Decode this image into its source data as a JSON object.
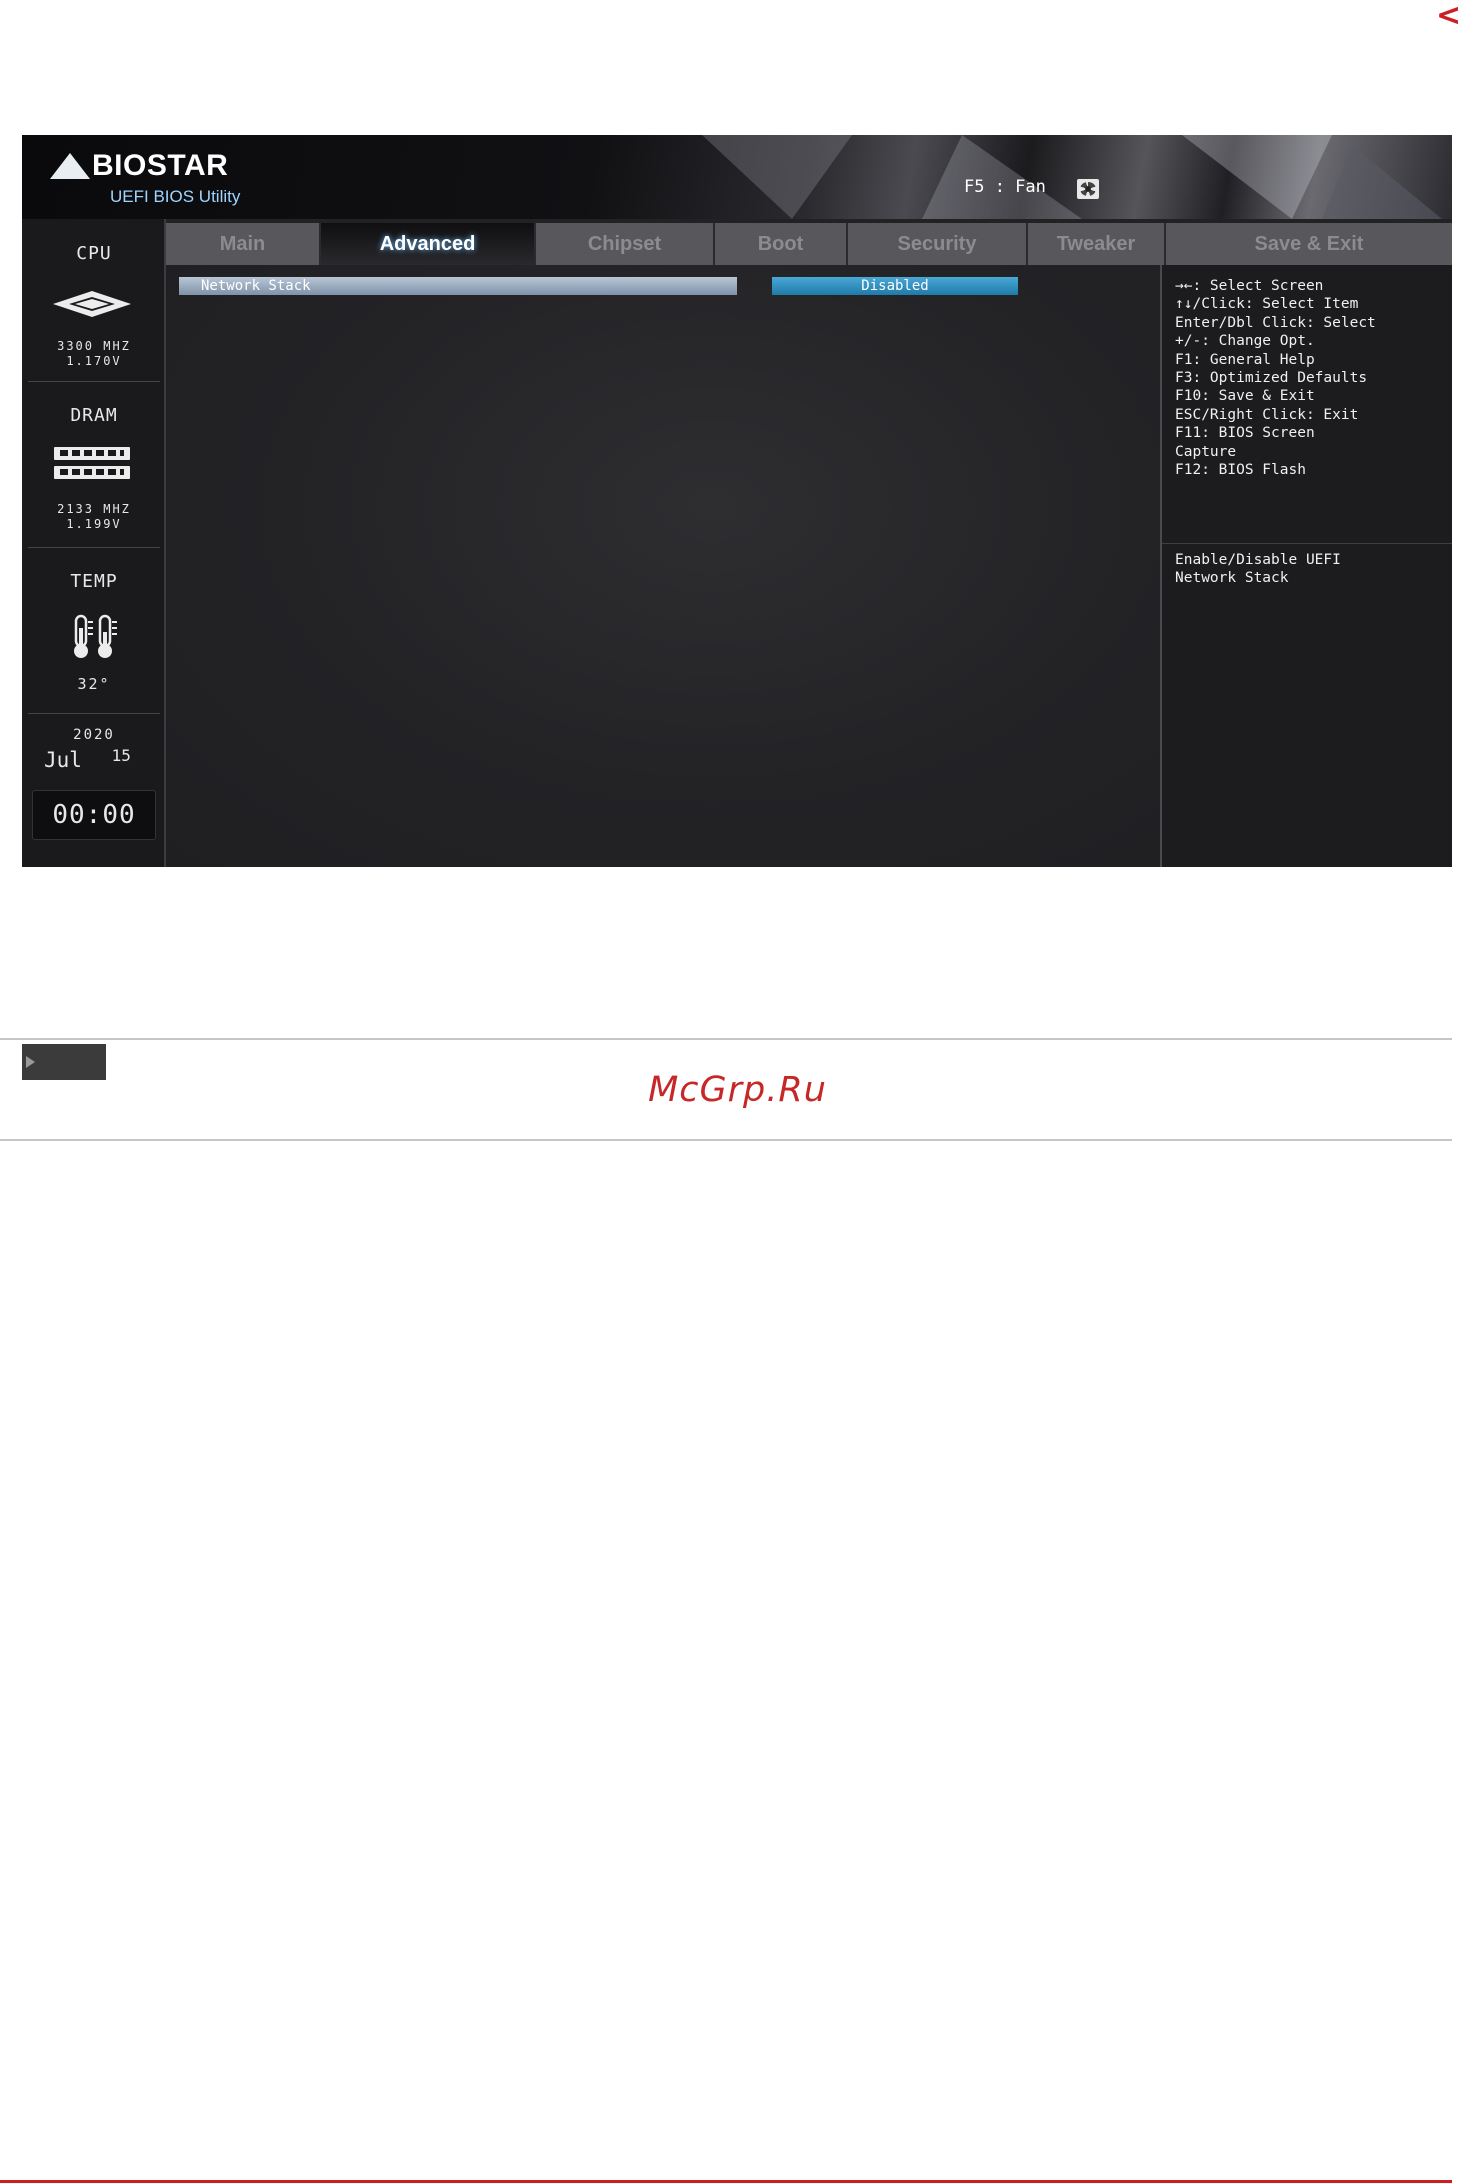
{
  "page": {
    "nav_arrow": "<",
    "watermark": "McGrp.Ru"
  },
  "header": {
    "brand": "BIOSTAR",
    "subtitle": "UEFI BIOS Utility",
    "fan_hint": "F5 : Fan"
  },
  "sidebar": {
    "cpu": {
      "title": "CPU",
      "freq": "3300 MHZ",
      "volt": "1.170V"
    },
    "dram": {
      "title": "DRAM",
      "freq": "2133 MHZ",
      "volt": "1.199V"
    },
    "temp": {
      "title": "TEMP",
      "value": "32°"
    },
    "date": {
      "year": "2020",
      "month": "Jul",
      "day": "15"
    },
    "clock": "00:00"
  },
  "tabs": [
    {
      "label": "Main"
    },
    {
      "label": "Advanced"
    },
    {
      "label": "Chipset"
    },
    {
      "label": "Boot"
    },
    {
      "label": "Security"
    },
    {
      "label": "Tweaker"
    },
    {
      "label": "Save & Exit"
    }
  ],
  "active_tab": "Advanced",
  "settings": [
    {
      "label": "Network Stack",
      "value": "Disabled"
    }
  ],
  "help": {
    "keys": "→←: Select Screen\n↑↓/Click: Select Item\nEnter/Dbl Click: Select\n+/-: Change Opt.\nF1: General Help\nF3: Optimized Defaults\nF10: Save & Exit\nESC/Right Click: Exit\nF11: BIOS Screen\nCapture\nF12: BIOS Flash",
    "description": "Enable/Disable UEFI\nNetwork Stack"
  },
  "colors": {
    "accent_red": "#cc1f1f",
    "value_blue": "#2b8fc0",
    "label_steel": "#9aaabd"
  }
}
